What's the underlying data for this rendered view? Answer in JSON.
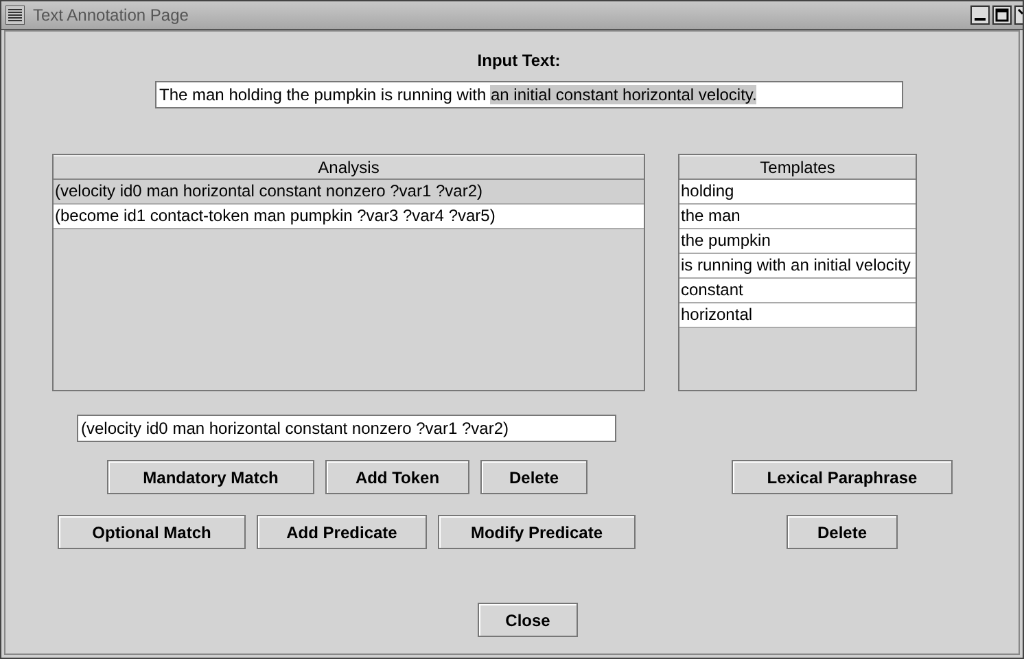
{
  "window": {
    "title": "Text Annotation Page"
  },
  "input_label": "Input Text:",
  "input_text": {
    "parts": [
      {
        "text": "The man holding the pumpkin is running with ",
        "selected": false
      },
      {
        "text": "an initial constant horizontal velocity.",
        "selected": true
      }
    ]
  },
  "analysis": {
    "header": "Analysis",
    "rows": [
      {
        "text": "(velocity id0 man horizontal constant nonzero ?var1 ?var2)",
        "selected": true
      },
      {
        "text": "(become id1 contact-token man pumpkin ?var3 ?var4 ?var5)",
        "selected": false
      }
    ]
  },
  "templates": {
    "header": "Templates",
    "rows": [
      {
        "text": "holding",
        "selected": false
      },
      {
        "text": "the man",
        "selected": false
      },
      {
        "text": "the pumpkin",
        "selected": false
      },
      {
        "text": "is running with an initial velocity",
        "selected": false
      },
      {
        "text": "constant",
        "selected": false
      },
      {
        "text": "horizontal",
        "selected": false
      }
    ]
  },
  "predicate_field": {
    "value": "(velocity id0 man horizontal constant nonzero ?var1 ?var2)"
  },
  "left_buttons_row1": [
    "Mandatory Match",
    "Add Token",
    "Delete"
  ],
  "left_buttons_row2": [
    "Optional Match",
    "Add Predicate",
    "Modify Predicate"
  ],
  "right_buttons": [
    "Lexical Paraphrase",
    "Delete"
  ],
  "close_button": "Close"
}
